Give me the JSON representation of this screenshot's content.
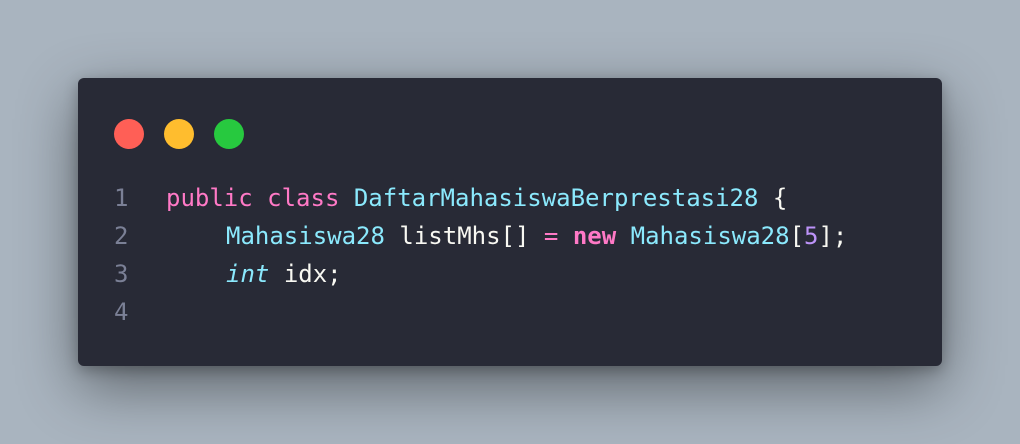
{
  "window": {
    "dots": [
      {
        "name": "close",
        "color": "#ff5f56"
      },
      {
        "name": "minimize",
        "color": "#ffbd2e"
      },
      {
        "name": "maximize",
        "color": "#27c93f"
      }
    ]
  },
  "code": {
    "lines": [
      {
        "number": "1",
        "tokens": {
          "kw_public": "public",
          "kw_class": "class",
          "class_name": "DaftarMahasiswaBerprestasi28",
          "brace": "{"
        }
      },
      {
        "number": "2",
        "tokens": {
          "type": "Mahasiswa28",
          "var": "listMhs[]",
          "eq": "=",
          "kw_new": "new",
          "ctor": "Mahasiswa28",
          "open": "[",
          "size": "5",
          "close": "];"
        }
      },
      {
        "number": "3",
        "tokens": {
          "type": "int",
          "var": "idx;"
        }
      },
      {
        "number": "4"
      }
    ]
  }
}
